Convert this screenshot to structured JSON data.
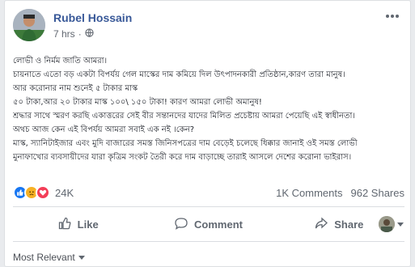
{
  "post": {
    "author": "Rubel Hossain",
    "time": "7 hrs",
    "time_separator": "·",
    "lines": [
      "লোভী ও নির্মম জাতি আমরা।",
      "চায়নাতে এতো বড় একটা বিপর্যয় গেল মাস্কের দাম কমিয়ে দিল উৎপাদনকারী প্রতিষ্ঠান,কারণ তারা মানুষ।",
      "আর করোনার নাম শুনেই ৫ টাকার মাস্ক",
      "৫০ টাকা,আর ২০ টাকার মাস্ক ১০০\\ ১৫০ টাকা! কারণ আমরা লোভী অমানুষ!",
      "শ্রদ্ধার সাথে স্মরণ করছি একাত্তরের সেই বীর সন্তানদের যাদের মিলিত প্রচেষ্টায় আমরা পেয়েছি এই স্বাধীনতা।",
      "অথচ আজ কেন এই বিপর্যয় আমরা সবাই এক নই ।কেন?",
      "মাস্ক, স্যানিটাইজার এবং মুদি বাজারের সমস্ত জিনিসপত্রের দাম বেড়েই চলেছে ধিক্কার জানাই ওই সমস্ত লোভী",
      "মুনাফাখোর ব্যবসায়ীদের যারা কৃত্রিম সংকট তৈরী করে দাম বাড়াচ্ছে তারাই আসলে দেশের করোনা ভাইরাস।"
    ]
  },
  "stats": {
    "reaction_count": "24K",
    "comments": "1K Comments",
    "shares": "962 Shares",
    "reaction_icons": [
      "like-icon",
      "sad-icon",
      "love-icon"
    ]
  },
  "actions": {
    "like": "Like",
    "comment": "Comment",
    "share": "Share"
  },
  "sort": {
    "label": "Most Relevant"
  },
  "colors": {
    "name": "#385898",
    "like_blue": "#1877f2",
    "love_red": "#f33e58",
    "sad_yellow": "#f7b125",
    "action_gray": "#606770"
  }
}
